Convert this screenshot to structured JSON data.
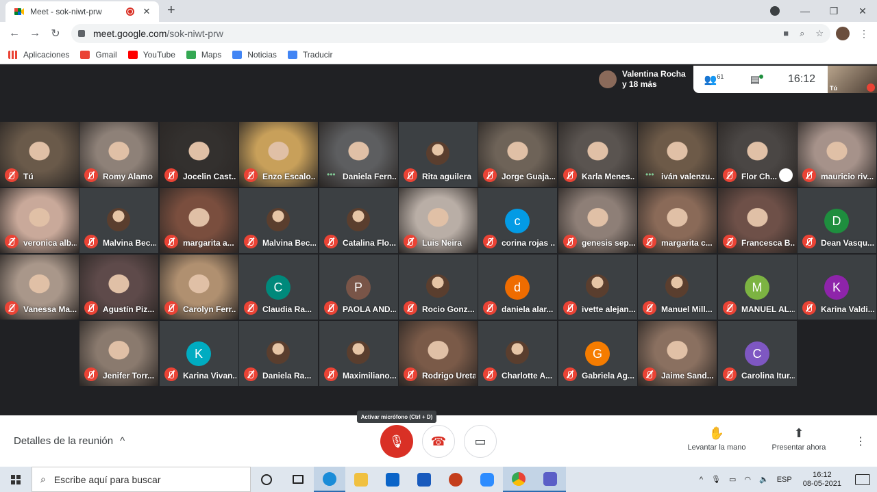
{
  "browser": {
    "tab_title": "Meet - sok-niwt-prw",
    "url_host": "meet.google.com",
    "url_path": "/sok-niwt-prw",
    "bookmarks": [
      "Aplicaciones",
      "Gmail",
      "YouTube",
      "Maps",
      "Noticias",
      "Traducir"
    ]
  },
  "meet": {
    "presenter_name": "Valentina Rocha y 18 más",
    "participant_count": "61",
    "clock": "16:12",
    "self_label": "Tú",
    "tooltip": "Activar micrófono (Ctrl + D)",
    "details_label": "Detalles de la reunión",
    "raise_hand_label": "Levantar la mano",
    "present_label": "Presentar ahora",
    "participants": [
      {
        "name": "Tú",
        "type": "video",
        "color": "#6a5a4a"
      },
      {
        "name": "Romy Alamo",
        "type": "video",
        "color": "#8e8178"
      },
      {
        "name": "Jocelin Cast...",
        "type": "video",
        "color": "#33302e"
      },
      {
        "name": "Enzo Escalo...",
        "type": "video",
        "color": "#c8a05a"
      },
      {
        "name": "Daniela Fern...",
        "type": "video",
        "color": "#5d5e60",
        "speaking": true
      },
      {
        "name": "Rita aguilera",
        "type": "photo",
        "color": "#3c4043"
      },
      {
        "name": "Jorge Guaja...",
        "type": "video",
        "color": "#6e6358"
      },
      {
        "name": "Karla Menes...",
        "type": "video",
        "color": "#5a5450"
      },
      {
        "name": "iván valenzu...",
        "type": "video",
        "color": "#6d5a48",
        "speaking": true
      },
      {
        "name": "Flor Ch...",
        "type": "video",
        "color": "#4a4644",
        "hand": true
      },
      {
        "name": "mauricio riv...",
        "type": "video",
        "color": "#a6928a"
      },
      {
        "name": "veronica alb...",
        "type": "video",
        "color": "#c9a99a"
      },
      {
        "name": "Malvina Bec...",
        "type": "photo",
        "color": "#3c4043"
      },
      {
        "name": "margarita a...",
        "type": "video",
        "color": "#7a4e3e"
      },
      {
        "name": "Malvina Bec...",
        "type": "photo",
        "color": "#3c4043"
      },
      {
        "name": "Catalina Flo...",
        "type": "photo",
        "color": "#3c4043"
      },
      {
        "name": "Luis Neira",
        "type": "video",
        "color": "#b9aea6"
      },
      {
        "name": "corina rojas ...",
        "type": "letter",
        "letter": "c",
        "color": "#039be5"
      },
      {
        "name": "genesis sep...",
        "type": "video",
        "color": "#8e7f77"
      },
      {
        "name": "margarita c...",
        "type": "video",
        "color": "#8a6a58"
      },
      {
        "name": "Francesca B...",
        "type": "video",
        "color": "#6e5048"
      },
      {
        "name": "Dean Vasqu...",
        "type": "letter",
        "letter": "D",
        "color": "#1e8e3e"
      },
      {
        "name": "Vanessa Ma...",
        "type": "video",
        "color": "#a9978a"
      },
      {
        "name": "Agustín Piz...",
        "type": "video",
        "color": "#5e4a4a"
      },
      {
        "name": "Carolyn Ferr...",
        "type": "video",
        "color": "#b09070"
      },
      {
        "name": "Claudia Ra...",
        "type": "letter",
        "letter": "C",
        "color": "#00897b"
      },
      {
        "name": "PAOLA AND...",
        "type": "letter",
        "letter": "P",
        "color": "#795548"
      },
      {
        "name": "Rocio Gonz...",
        "type": "photo",
        "color": "#3c4043"
      },
      {
        "name": "daniela alar...",
        "type": "letter",
        "letter": "d",
        "color": "#ef6c00"
      },
      {
        "name": "ivette alejan...",
        "type": "photo",
        "color": "#3c4043"
      },
      {
        "name": "Manuel Mill...",
        "type": "photo",
        "color": "#3c4043"
      },
      {
        "name": "MANUEL AL...",
        "type": "letter",
        "letter": "M",
        "color": "#7cb342"
      },
      {
        "name": "Karina Valdi...",
        "type": "letter",
        "letter": "K",
        "color": "#8e24aa"
      },
      {
        "name": "Jenifer Torr...",
        "type": "video",
        "color": "#8a7a6e"
      },
      {
        "name": "Karina Vivan...",
        "type": "letter",
        "letter": "K",
        "color": "#00acc1"
      },
      {
        "name": "Daniela Ra...",
        "type": "photo",
        "color": "#3c4043"
      },
      {
        "name": "Maximiliano...",
        "type": "photo",
        "color": "#3c4043"
      },
      {
        "name": "Rodrigo Ureta",
        "type": "video",
        "color": "#7a5a48"
      },
      {
        "name": "Charlotte A...",
        "type": "photo",
        "color": "#3c4043"
      },
      {
        "name": "Gabriela Ag...",
        "type": "letter",
        "letter": "G",
        "color": "#f57c00"
      },
      {
        "name": "Jaime Sand...",
        "type": "video",
        "color": "#8a7060"
      },
      {
        "name": "Carolina Itur...",
        "type": "letter",
        "letter": "C",
        "color": "#7e57c2"
      }
    ]
  },
  "taskbar": {
    "search_placeholder": "Escribe aquí para buscar",
    "lang": "ESP",
    "time": "16:12",
    "date": "08-05-2021"
  }
}
